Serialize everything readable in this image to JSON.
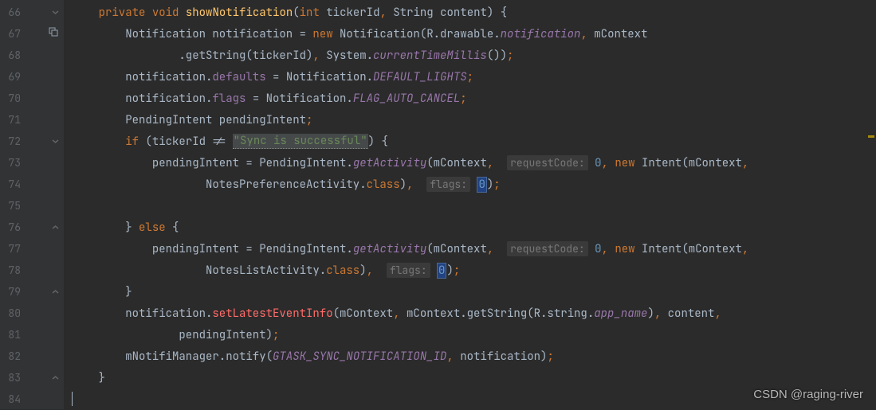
{
  "gutter": {
    "line_numbers": [
      "66",
      "67",
      "68",
      "69",
      "70",
      "71",
      "72",
      "73",
      "74",
      "75",
      "76",
      "77",
      "78",
      "79",
      "80",
      "81",
      "82",
      "83",
      "84"
    ]
  },
  "code": {
    "l66": {
      "indent": "    ",
      "kw1": "private",
      "sp1": " ",
      "kw2": "void",
      "sp2": " ",
      "name": "showNotification",
      "p1": "(",
      "type1": "int",
      "sp3": " ",
      "arg1": "tickerId",
      "comma1": ",",
      "sp4": " ",
      "type2": "String",
      "sp5": " ",
      "arg2": "content",
      "p2": ")",
      "sp6": " ",
      "brace": "{"
    },
    "l67": {
      "indent": "        ",
      "t1": "Notification notification ",
      "eq": "=",
      "sp1": " ",
      "kw": "new",
      "sp2": " ",
      "t2": "Notification(R.drawable.",
      "field": "notification",
      "comma": ",",
      "sp3": " ",
      "arg": "mContext"
    },
    "l68": {
      "indent": "                ",
      "t1": ".getString(tickerId)",
      "comma": ",",
      "sp1": " ",
      "t2": "System.",
      "method": "currentTimeMillis",
      "t3": "())",
      "semi": ";"
    },
    "l69": {
      "indent": "        ",
      "t1": "notification.",
      "field": "defaults",
      "sp1": " ",
      "eq": "=",
      "sp2": " ",
      "t2": "Notification.",
      "const": "DEFAULT_LIGHTS",
      "semi": ";"
    },
    "l70": {
      "indent": "        ",
      "t1": "notification.",
      "field": "flags",
      "sp1": " ",
      "eq": "=",
      "sp2": " ",
      "t2": "Notification.",
      "const": "FLAG_AUTO_CANCEL",
      "semi": ";"
    },
    "l71": {
      "indent": "        ",
      "t1": "PendingIntent pendingIntent",
      "semi": ";"
    },
    "l72": {
      "indent": "        ",
      "kw": "if",
      "sp1": " ",
      "t1": "(tickerId != ",
      "str": "\"Sync is successful\"",
      "t2": ")",
      "sp2": " ",
      "brace": "{"
    },
    "l73": {
      "indent": "            ",
      "t1": "pendingIntent ",
      "eq": "=",
      "sp1": " ",
      "t2": "PendingIntent.",
      "method": "getActivity",
      "t3": "(mContext",
      "comma1": ",",
      "sp2": "  ",
      "hint": "requestCode:",
      "sp3": " ",
      "num": "0",
      "comma2": ",",
      "sp4": " ",
      "kw": "new",
      "sp5": " ",
      "t4": "Intent(mContext",
      "comma3": ","
    },
    "l74": {
      "indent": "                    ",
      "t1": "NotesPreferenceActivity.",
      "kw": "class",
      "t2": ")",
      "comma": ",",
      "sp1": "  ",
      "hint": "flags:",
      "sp2": " ",
      "num": "0",
      "t3": ")",
      "semi": ";"
    },
    "l75": {
      "indent": ""
    },
    "l76": {
      "indent": "        ",
      "brace1": "}",
      "sp1": " ",
      "kw": "else",
      "sp2": " ",
      "brace2": "{"
    },
    "l77": {
      "indent": "            ",
      "t1": "pendingIntent ",
      "eq": "=",
      "sp1": " ",
      "t2": "PendingIntent.",
      "method": "getActivity",
      "t3": "(mContext",
      "comma1": ",",
      "sp2": "  ",
      "hint": "requestCode:",
      "sp3": " ",
      "num": "0",
      "comma2": ",",
      "sp4": " ",
      "kw": "new",
      "sp5": " ",
      "t4": "Intent(mContext",
      "comma3": ","
    },
    "l78": {
      "indent": "                    ",
      "t1": "NotesListActivity.",
      "kw": "class",
      "t2": ")",
      "comma": ",",
      "sp1": "  ",
      "hint": "flags:",
      "sp2": " ",
      "num": "0",
      "t3": ")",
      "semi": ";"
    },
    "l79": {
      "indent": "        ",
      "brace": "}"
    },
    "l80": {
      "indent": "        ",
      "t1": "notification.",
      "method": "setLatestEventInfo",
      "t2": "(mContext",
      "comma1": ",",
      "sp1": " ",
      "t3": "mContext.getString(R.string.",
      "field": "app_name",
      "t4": ")",
      "comma2": ",",
      "sp2": " ",
      "t5": "content",
      "comma3": ","
    },
    "l81": {
      "indent": "                ",
      "t1": "pendingIntent)",
      "semi": ";"
    },
    "l82": {
      "indent": "        ",
      "t1": "mNotifiManager.notify(",
      "const": "GTASK_SYNC_NOTIFICATION_ID",
      "comma": ",",
      "sp1": " ",
      "t2": "notification)",
      "semi": ";"
    },
    "l83": {
      "indent": "    ",
      "brace": "}"
    }
  },
  "watermark": "CSDN @raging-river"
}
